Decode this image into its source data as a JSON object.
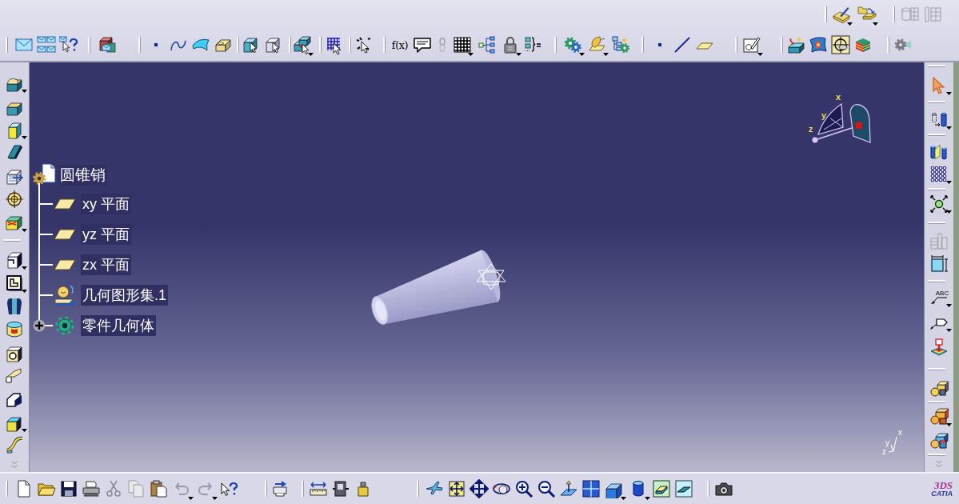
{
  "toolbar": {
    "formula_label": "f(x)"
  },
  "specification_tree": {
    "root": {
      "label": "圆锥销",
      "children": [
        {
          "kind": "plane",
          "label": "xy 平面"
        },
        {
          "kind": "plane",
          "label": "yz 平面"
        },
        {
          "kind": "plane",
          "label": "zx 平面"
        },
        {
          "kind": "geometrical_set",
          "label": "几何图形集.1"
        },
        {
          "kind": "body",
          "label": "零件几何体",
          "expanded": false
        }
      ]
    }
  },
  "compass": {
    "axis_labels": [
      "x",
      "y",
      "z"
    ]
  },
  "annotation_toolbar": {
    "text_tool_label": "ABC"
  },
  "axis_triad": {
    "axis_labels": [
      "x",
      "y",
      "z"
    ]
  },
  "logo": {
    "mark": "3DS",
    "name": "CATIA"
  }
}
